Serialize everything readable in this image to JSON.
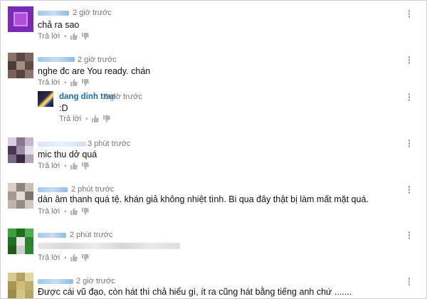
{
  "actions": {
    "reply_label": "Trả lời",
    "separator": "•"
  },
  "icons": {
    "like": "thumbs-up-icon",
    "dislike": "thumbs-down-icon",
    "menu": "vertical-dots-icon"
  },
  "colors": {
    "author_link": "#1a6bb3",
    "meta": "#767676"
  },
  "comments": [
    {
      "time": "2 giờ trước",
      "text": "chả ra sao"
    },
    {
      "time": "2 giờ trước",
      "text": "nghe đc are You ready.  chán",
      "reply": {
        "author": "dang dinh tran",
        "time": "2 giờ trước",
        "text": ":D"
      }
    },
    {
      "time": "3 phút trước",
      "text": "mic thu dở quá"
    },
    {
      "time": "2 phút trước",
      "text": "dàn âm thanh quá tệ. khán giả không nhiệt tình. Bi qua đây thật bị làm mất mặt quá."
    },
    {
      "time": "2 phút trước",
      "text": ""
    },
    {
      "time": "2 giờ trước",
      "text": "Được cái vũ đạo, còn hát thì chả hiểu gì, ít ra cũng hát bằng tiếng anh chứ ......."
    }
  ]
}
